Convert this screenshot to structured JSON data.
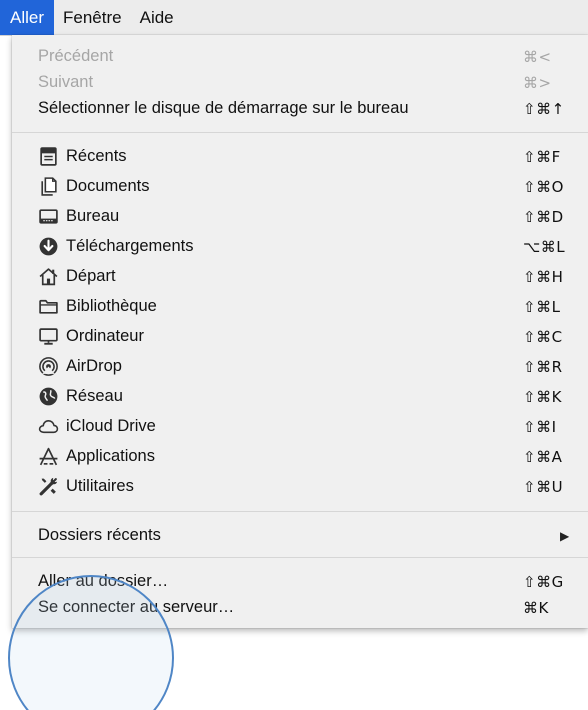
{
  "menubar": {
    "items": [
      {
        "label": "Aller",
        "active": true
      },
      {
        "label": "Fenêtre",
        "active": false
      },
      {
        "label": "Aide",
        "active": false
      }
    ]
  },
  "menu": {
    "group1": [
      {
        "label": "Précédent",
        "shortcut": "⌘<",
        "enabled": false
      },
      {
        "label": "Suivant",
        "shortcut": "⌘>",
        "enabled": false
      },
      {
        "label": "Sélectionner le disque de démarrage sur le bureau",
        "shortcut": "⇧⌘↑",
        "enabled": true
      }
    ],
    "group2": [
      {
        "label": "Récents",
        "shortcut": "⇧⌘F",
        "icon": "recents-icon"
      },
      {
        "label": "Documents",
        "shortcut": "⇧⌘O",
        "icon": "documents-icon"
      },
      {
        "label": "Bureau",
        "shortcut": "⇧⌘D",
        "icon": "desktop-icon"
      },
      {
        "label": "Téléchargements",
        "shortcut": "⌥⌘L",
        "icon": "downloads-icon"
      },
      {
        "label": "Départ",
        "shortcut": "⇧⌘H",
        "icon": "home-icon"
      },
      {
        "label": "Bibliothèque",
        "shortcut": "⇧⌘L",
        "icon": "library-folder-icon"
      },
      {
        "label": "Ordinateur",
        "shortcut": "⇧⌘C",
        "icon": "computer-icon"
      },
      {
        "label": "AirDrop",
        "shortcut": "⇧⌘R",
        "icon": "airdrop-icon"
      },
      {
        "label": "Réseau",
        "shortcut": "⇧⌘K",
        "icon": "network-globe-icon"
      },
      {
        "label": "iCloud Drive",
        "shortcut": "⇧⌘I",
        "icon": "icloud-icon"
      },
      {
        "label": "Applications",
        "shortcut": "⇧⌘A",
        "icon": "applications-icon"
      },
      {
        "label": "Utilitaires",
        "shortcut": "⇧⌘U",
        "icon": "utilities-tools-icon"
      }
    ],
    "group3": [
      {
        "label": "Dossiers récents",
        "submenu_arrow": "▶"
      }
    ],
    "group4": [
      {
        "label": "Aller au dossier…",
        "shortcut": "⇧⌘G"
      },
      {
        "label": "Se connecter au serveur…",
        "shortcut": "⌘K"
      }
    ]
  },
  "colors": {
    "menubar_highlight": "#2165d9",
    "menu_background": "#f0f0f0",
    "disabled_text": "#a6a6a6",
    "magnifier_ring": "#4f86c6"
  }
}
